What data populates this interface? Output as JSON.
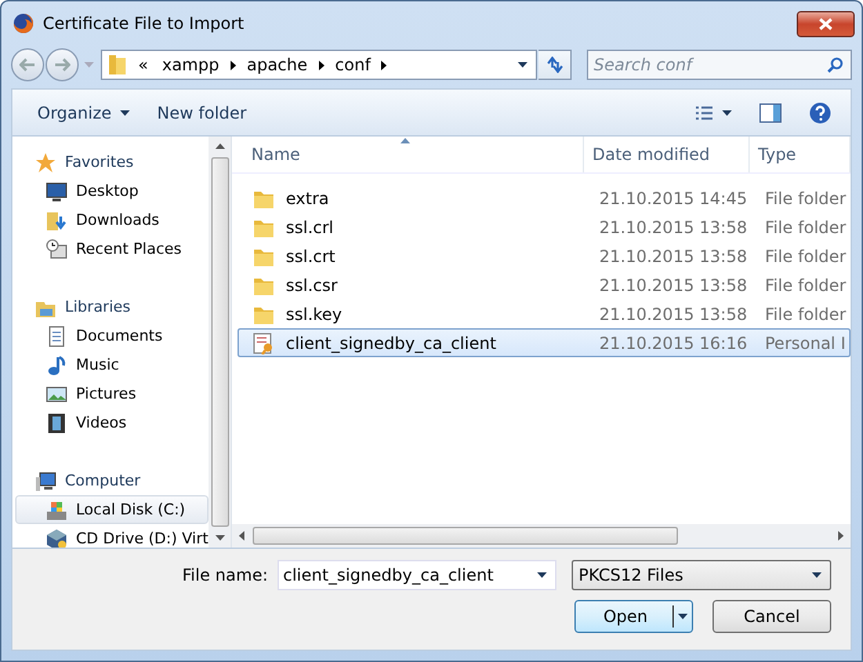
{
  "window": {
    "title": "Certificate File to Import"
  },
  "address_bar": {
    "overflow": "«",
    "segments": [
      "xampp",
      "apache",
      "conf"
    ]
  },
  "search": {
    "placeholder": "Search conf"
  },
  "toolbar": {
    "buttons": [
      {
        "label": "Organize",
        "dropdown": true
      },
      {
        "label": "New folder",
        "dropdown": false
      }
    ]
  },
  "sidebar": {
    "groups": [
      {
        "label": "Favorites",
        "kind": "favorites",
        "children": [
          {
            "label": "Desktop",
            "kind": "desktop",
            "selected": false
          },
          {
            "label": "Downloads",
            "kind": "downloads",
            "selected": false
          },
          {
            "label": "Recent Places",
            "kind": "recent",
            "selected": false
          }
        ]
      },
      {
        "label": "Libraries",
        "kind": "libraries",
        "children": [
          {
            "label": "Documents",
            "kind": "documents",
            "selected": false
          },
          {
            "label": "Music",
            "kind": "music",
            "selected": false
          },
          {
            "label": "Pictures",
            "kind": "pictures",
            "selected": false
          },
          {
            "label": "Videos",
            "kind": "videos",
            "selected": false
          }
        ]
      },
      {
        "label": "Computer",
        "kind": "computer",
        "children": [
          {
            "label": "Local Disk (C:)",
            "kind": "disk",
            "selected": true
          },
          {
            "label": "CD Drive (D:) Virt",
            "kind": "cd",
            "selected": false
          }
        ]
      }
    ]
  },
  "table": {
    "columns": [
      "Name",
      "Date modified",
      "Type"
    ],
    "rows": [
      {
        "name": "extra",
        "date": "21.10.2015 14:45",
        "type": "File folder",
        "kind": "folder",
        "selected": false
      },
      {
        "name": "ssl.crl",
        "date": "21.10.2015 13:58",
        "type": "File folder",
        "kind": "folder",
        "selected": false
      },
      {
        "name": "ssl.crt",
        "date": "21.10.2015 13:58",
        "type": "File folder",
        "kind": "folder",
        "selected": false
      },
      {
        "name": "ssl.csr",
        "date": "21.10.2015 13:58",
        "type": "File folder",
        "kind": "folder",
        "selected": false
      },
      {
        "name": "ssl.key",
        "date": "21.10.2015 13:58",
        "type": "File folder",
        "kind": "folder",
        "selected": false
      },
      {
        "name": "client_signedby_ca_client",
        "date": "21.10.2015 16:16",
        "type": "Personal I",
        "kind": "certificate",
        "selected": true
      }
    ]
  },
  "file_name": {
    "label": "File name:",
    "value": "client_signedby_ca_client"
  },
  "file_type": {
    "value": "PKCS12 Files"
  },
  "buttons": [
    {
      "label": "Open",
      "split": true
    },
    {
      "label": "Cancel",
      "split": false
    }
  ]
}
